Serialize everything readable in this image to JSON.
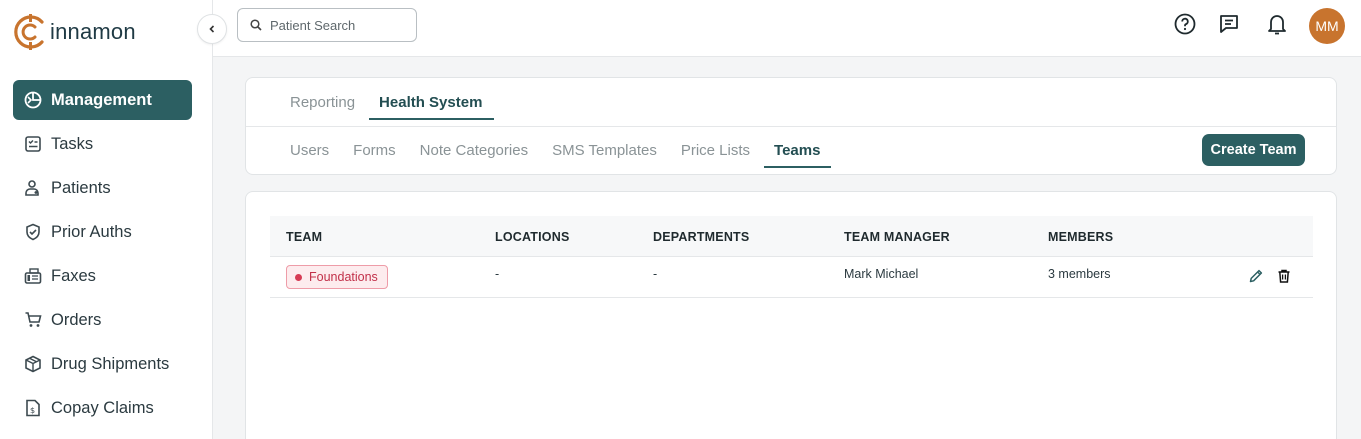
{
  "brand": {
    "logo_text": "innamon",
    "accent": "#2c5f62",
    "logo_color": "#c8742e"
  },
  "sidebar": {
    "items": [
      {
        "label": "Management",
        "icon": "management-icon",
        "active": true
      },
      {
        "label": "Tasks",
        "icon": "tasks-icon"
      },
      {
        "label": "Patients",
        "icon": "patients-icon"
      },
      {
        "label": "Prior Auths",
        "icon": "shield-check-icon"
      },
      {
        "label": "Faxes",
        "icon": "fax-icon"
      },
      {
        "label": "Orders",
        "icon": "cart-icon"
      },
      {
        "label": "Drug Shipments",
        "icon": "package-icon"
      },
      {
        "label": "Copay Claims",
        "icon": "claim-icon"
      }
    ]
  },
  "header": {
    "search_placeholder": "Patient Search",
    "avatar_initials": "MM"
  },
  "primary_tabs": [
    {
      "label": "Reporting",
      "active": false
    },
    {
      "label": "Health System",
      "active": true
    }
  ],
  "secondary_tabs": [
    {
      "label": "Users",
      "active": false
    },
    {
      "label": "Forms",
      "active": false
    },
    {
      "label": "Note Categories",
      "active": false
    },
    {
      "label": "SMS Templates",
      "active": false
    },
    {
      "label": "Price Lists",
      "active": false
    },
    {
      "label": "Teams",
      "active": true
    }
  ],
  "create_button": "Create Team",
  "table": {
    "columns": [
      "TEAM",
      "LOCATIONS",
      "DEPARTMENTS",
      "TEAM MANAGER",
      "MEMBERS"
    ],
    "rows": [
      {
        "team": "Foundations",
        "locations": "-",
        "departments": "-",
        "manager": "Mark Michael",
        "members": "3 members",
        "badge_color": "#d63b54"
      }
    ]
  }
}
